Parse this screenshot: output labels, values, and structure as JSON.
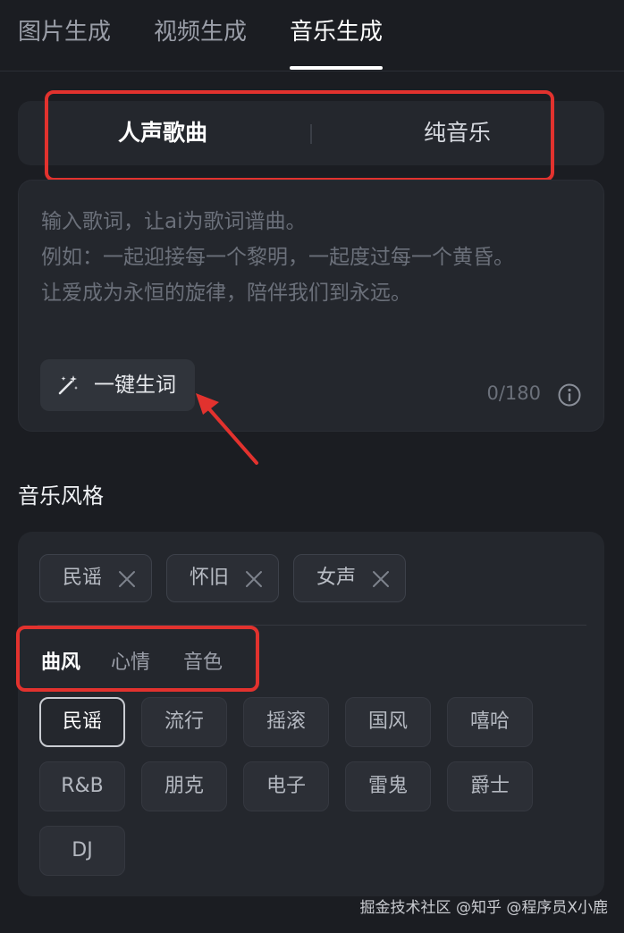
{
  "top_tabs": [
    {
      "label": "图片生成",
      "active": false
    },
    {
      "label": "视频生成",
      "active": false
    },
    {
      "label": "音乐生成",
      "active": true
    }
  ],
  "mode_toggle": {
    "vocal": "人声歌曲",
    "instrumental": "纯音乐",
    "selected": "人声歌曲"
  },
  "lyrics": {
    "placeholder_lines": [
      "输入歌词，让ai为歌词谱曲。",
      "例如：一起迎接每一个黎明，一起度过每一个黄昏。",
      "让爱成为永恒的旋律，陪伴我们到永远。"
    ],
    "generate_button": "一键生词",
    "counter": "0/180"
  },
  "music_style": {
    "title": "音乐风格",
    "selected_tags": [
      "民谣",
      "怀旧",
      "女声"
    ],
    "category_tabs": [
      "曲风",
      "心情",
      "音色"
    ],
    "active_category": "曲风",
    "genres": [
      "民谣",
      "流行",
      "摇滚",
      "国风",
      "嘻哈",
      "R&B",
      "朋克",
      "电子",
      "雷鬼",
      "爵士",
      "DJ"
    ],
    "active_genre": "民谣"
  },
  "watermark": "掘金技术社区 @知乎 @程序员X小鹿",
  "colors": {
    "background": "#1b1d22",
    "panel": "#24272d",
    "annotation_red": "#e2322e"
  }
}
